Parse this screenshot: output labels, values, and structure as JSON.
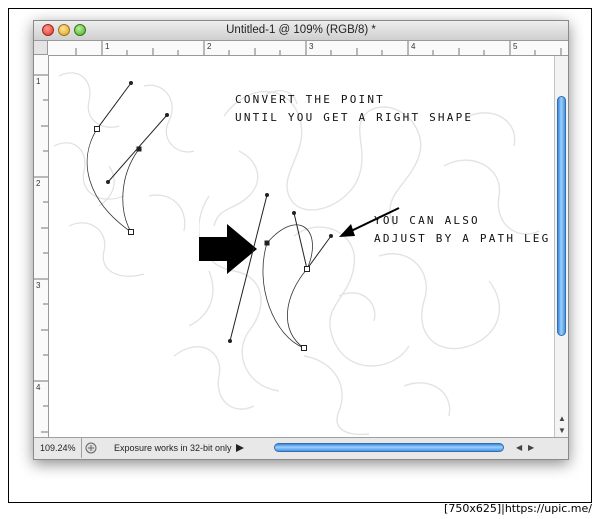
{
  "window": {
    "title": "Untitled-1 @ 109% (RGB/8) *"
  },
  "rulers": {
    "horizontal_labels": [
      "1",
      "2",
      "3",
      "4",
      "5"
    ],
    "vertical_labels": [
      "1",
      "2",
      "3",
      "4"
    ]
  },
  "annotations": {
    "line1": "CONVERT THE POINT",
    "line2": "UNTIL YOU GET A RIGHT SHAPE",
    "line3": "YOU CAN ALSO",
    "line4": "ADJUST BY A PATH LEG"
  },
  "status": {
    "zoom": "109.24%",
    "info": "Exposure works in 32-bit only"
  },
  "footer": {
    "text": "[750x625]|https://upic.me/"
  },
  "colors": {
    "scroll_thumb": "#4c93df",
    "arrow": "#000000"
  }
}
